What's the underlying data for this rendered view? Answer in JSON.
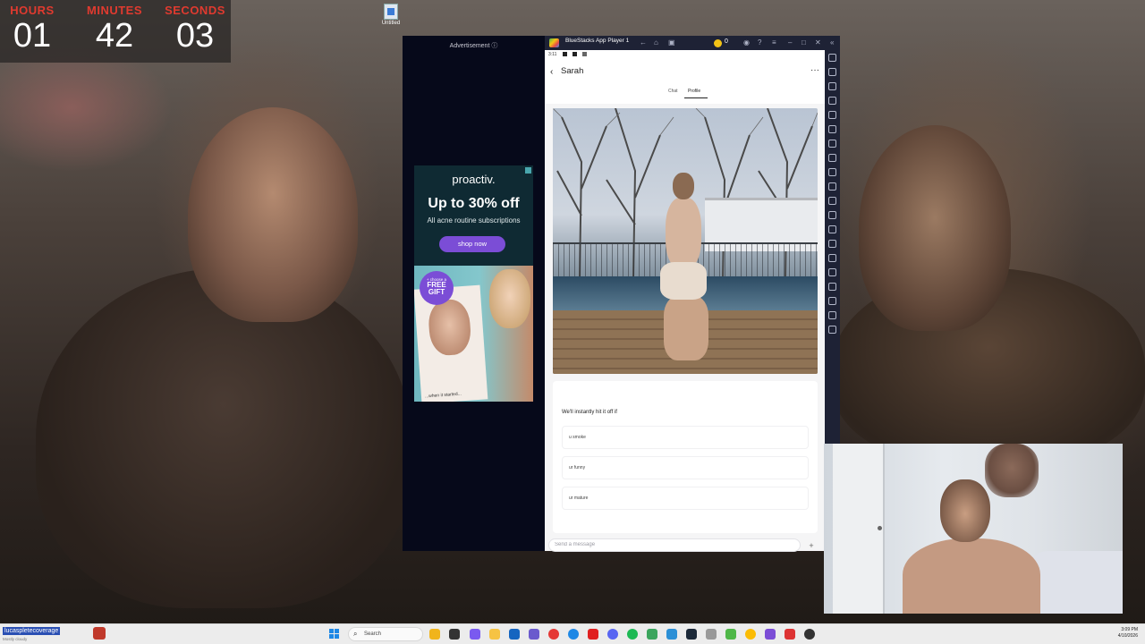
{
  "timer": {
    "hours_label": "HOURS",
    "hours_value": "01",
    "minutes_label": "MINUTES",
    "minutes_value": "42",
    "seconds_label": "SECONDS",
    "seconds_value": "03"
  },
  "desktop": {
    "icon_label": "Untitled",
    "icon": "document-icon"
  },
  "ad": {
    "label": "Advertisement ⓘ",
    "brand": "proactiv.",
    "headline": "Up to 30% off",
    "subtext": "All acne routine subscriptions",
    "cta": "shop now",
    "burst_small": "+ choose a",
    "burst_big": "FREE GIFT",
    "caption": "...when it started..."
  },
  "bluestacks": {
    "title": "BlueStacks App Player 1",
    "coin_count": "0",
    "status_time": "3:11"
  },
  "chat": {
    "contact_name": "Sarah",
    "back_icon": "chevron-left-icon",
    "more_icon": "more-horizontal-icon",
    "tabs": [
      {
        "label": "Chat",
        "active": false
      },
      {
        "label": "Profile",
        "active": true
      }
    ],
    "prompt_title": "We'll instantly hit it off if",
    "prompt_options": [
      "u smoke",
      "ur funny",
      "ur mature"
    ],
    "composer_placeholder": "Send a message",
    "send_icon": "plus-icon"
  },
  "taskbar": {
    "user_badge": "lucaspletecoverage",
    "user_sub": "Mostly cloudy",
    "search_label": "Search",
    "time": "3:09 PM",
    "date": "4/10/2026"
  },
  "colors": {
    "timer_label": "#e03a2f",
    "ad_button": "#7b4dd6",
    "bluestacks_chrome": "#1e2235",
    "coin": "#f3c316"
  }
}
